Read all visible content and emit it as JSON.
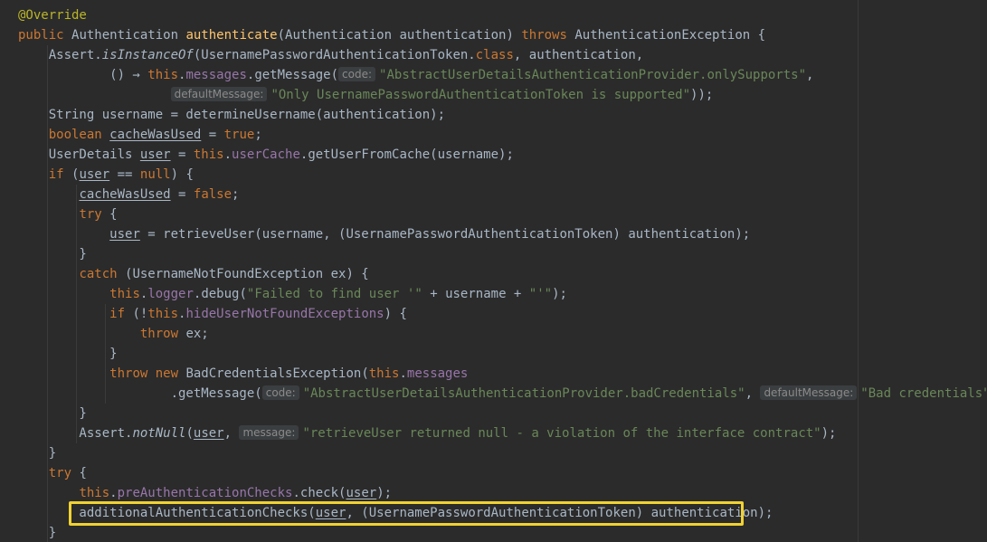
{
  "editor": {
    "lines": [
      [
        {
          "t": "@Override",
          "c": "ann"
        }
      ],
      [
        {
          "t": "public ",
          "c": "kw"
        },
        {
          "t": "Authentication "
        },
        {
          "t": "authenticate",
          "c": "fn"
        },
        {
          "t": "(Authentication authentication) "
        },
        {
          "t": "throws ",
          "c": "kw"
        },
        {
          "t": "AuthenticationException {"
        }
      ],
      [
        {
          "t": "    Assert."
        },
        {
          "t": "isInstanceOf",
          "c": "it"
        },
        {
          "t": "(UsernamePasswordAuthenticationToken."
        },
        {
          "t": "class",
          "c": "kw"
        },
        {
          "t": ", authentication,"
        }
      ],
      [
        {
          "t": "            () → "
        },
        {
          "t": "this",
          "c": "kw"
        },
        {
          "t": "."
        },
        {
          "t": "messages",
          "c": "fld"
        },
        {
          "t": ".getMessage("
        },
        {
          "t": "code:",
          "c": "hint"
        },
        {
          "t": "\"AbstractUserDetailsAuthenticationProvider.onlySupports\"",
          "c": "st"
        },
        {
          "t": ","
        }
      ],
      [
        {
          "t": "                    "
        },
        {
          "t": "defaultMessage:",
          "c": "hint"
        },
        {
          "t": "\"Only UsernamePasswordAuthenticationToken is supported\"",
          "c": "st"
        },
        {
          "t": "));"
        }
      ],
      [
        {
          "t": "    String username = determineUsername(authentication);"
        }
      ],
      [
        {
          "t": "    "
        },
        {
          "t": "boolean ",
          "c": "kw"
        },
        {
          "t": "cacheWasUsed",
          "c": "ul"
        },
        {
          "t": " = "
        },
        {
          "t": "true",
          "c": "kw"
        },
        {
          "t": ";"
        }
      ],
      [
        {
          "t": "    UserDetails "
        },
        {
          "t": "user",
          "c": "ul"
        },
        {
          "t": " = "
        },
        {
          "t": "this",
          "c": "kw"
        },
        {
          "t": "."
        },
        {
          "t": "userCache",
          "c": "fld"
        },
        {
          "t": ".getUserFromCache(username);"
        }
      ],
      [
        {
          "t": "    "
        },
        {
          "t": "if ",
          "c": "kw"
        },
        {
          "t": "("
        },
        {
          "t": "user",
          "c": "ul"
        },
        {
          "t": " == "
        },
        {
          "t": "null",
          "c": "kw"
        },
        {
          "t": ") {"
        }
      ],
      [
        {
          "t": "        "
        },
        {
          "t": "cacheWasUsed",
          "c": "ul"
        },
        {
          "t": " = "
        },
        {
          "t": "false",
          "c": "kw"
        },
        {
          "t": ";"
        }
      ],
      [
        {
          "t": "        "
        },
        {
          "t": "try ",
          "c": "kw"
        },
        {
          "t": "{"
        }
      ],
      [
        {
          "t": "            "
        },
        {
          "t": "user",
          "c": "ul"
        },
        {
          "t": " = retrieveUser(username, (UsernamePasswordAuthenticationToken) authentication);"
        }
      ],
      [
        {
          "t": "        }"
        }
      ],
      [
        {
          "t": "        "
        },
        {
          "t": "catch ",
          "c": "kw"
        },
        {
          "t": "(UsernameNotFoundException ex) {"
        }
      ],
      [
        {
          "t": "            "
        },
        {
          "t": "this",
          "c": "kw"
        },
        {
          "t": "."
        },
        {
          "t": "logger",
          "c": "fld"
        },
        {
          "t": ".debug("
        },
        {
          "t": "\"Failed to find user '\"",
          "c": "st"
        },
        {
          "t": " + username + "
        },
        {
          "t": "\"'\"",
          "c": "st"
        },
        {
          "t": ");"
        }
      ],
      [
        {
          "t": "            "
        },
        {
          "t": "if ",
          "c": "kw"
        },
        {
          "t": "(!"
        },
        {
          "t": "this",
          "c": "kw"
        },
        {
          "t": "."
        },
        {
          "t": "hideUserNotFoundExceptions",
          "c": "fld"
        },
        {
          "t": ") {"
        }
      ],
      [
        {
          "t": "                "
        },
        {
          "t": "throw ",
          "c": "kw"
        },
        {
          "t": "ex;"
        }
      ],
      [
        {
          "t": "            }"
        }
      ],
      [
        {
          "t": "            "
        },
        {
          "t": "throw new ",
          "c": "kw"
        },
        {
          "t": "BadCredentialsException("
        },
        {
          "t": "this",
          "c": "kw"
        },
        {
          "t": "."
        },
        {
          "t": "messages",
          "c": "fld"
        }
      ],
      [
        {
          "t": "                    .getMessage("
        },
        {
          "t": "code:",
          "c": "hint"
        },
        {
          "t": "\"AbstractUserDetailsAuthenticationProvider.badCredentials\"",
          "c": "st"
        },
        {
          "t": ", "
        },
        {
          "t": "defaultMessage:",
          "c": "hint"
        },
        {
          "t": "\"Bad credentials\"",
          "c": "st"
        },
        {
          "t": "));"
        }
      ],
      [
        {
          "t": "        }"
        }
      ],
      [
        {
          "t": "        Assert."
        },
        {
          "t": "notNull",
          "c": "it"
        },
        {
          "t": "("
        },
        {
          "t": "user",
          "c": "ul"
        },
        {
          "t": ", "
        },
        {
          "t": "message:",
          "c": "hint"
        },
        {
          "t": "\"retrieveUser returned null - a violation of the interface contract\"",
          "c": "st"
        },
        {
          "t": ");"
        }
      ],
      [
        {
          "t": "    }"
        }
      ],
      [
        {
          "t": "    "
        },
        {
          "t": "try ",
          "c": "kw"
        },
        {
          "t": "{"
        }
      ],
      [
        {
          "t": "        "
        },
        {
          "t": "this",
          "c": "kw"
        },
        {
          "t": "."
        },
        {
          "t": "preAuthenticationChecks",
          "c": "fld"
        },
        {
          "t": ".check("
        },
        {
          "t": "user",
          "c": "ul"
        },
        {
          "t": ");"
        }
      ],
      [
        {
          "t": "        additionalAuthenticationChecks("
        },
        {
          "t": "user",
          "c": "ul"
        },
        {
          "t": ", (UsernamePasswordAuthenticationToken) authentication);"
        }
      ],
      [
        {
          "t": "    }"
        }
      ]
    ],
    "colors": {
      "background": "#2b2b2b",
      "keyword": "#cc7832",
      "method": "#ffc66d",
      "string": "#6a8759",
      "field": "#9876aa",
      "annotation": "#bbb529",
      "highlight": "#f0d232"
    }
  }
}
